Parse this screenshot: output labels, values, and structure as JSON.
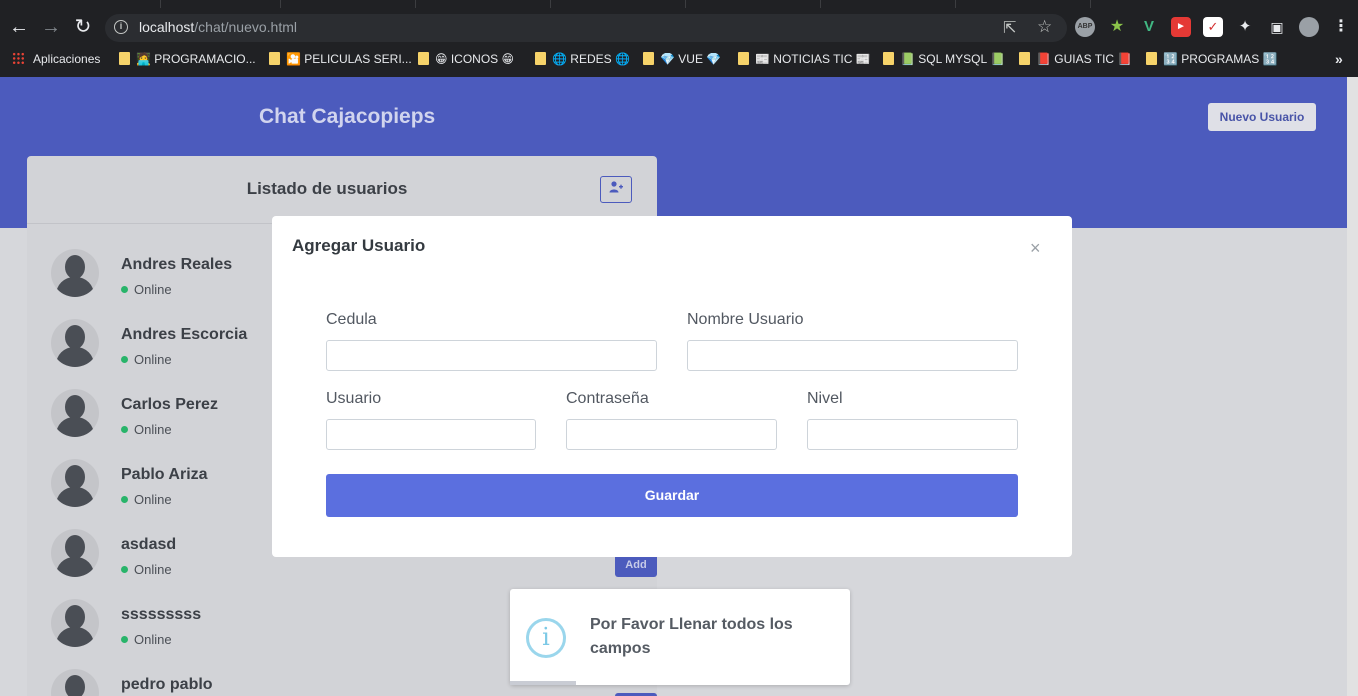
{
  "browser": {
    "url_host": "localhost",
    "url_path": "/chat/nuevo.html",
    "bookmarks": [
      {
        "label": "Aplicaciones",
        "icon": "apps-grid-icon"
      },
      {
        "label": "🧑‍💻 PROGRAMACIO...",
        "icon": "folder-icon"
      },
      {
        "label": "🎦 PELICULAS SERI...",
        "icon": "folder-icon"
      },
      {
        "label": "😁 ICONOS 😁",
        "icon": "folder-icon"
      },
      {
        "label": "🌐 REDES 🌐",
        "icon": "folder-icon"
      },
      {
        "label": "💎 VUE 💎",
        "icon": "folder-icon"
      },
      {
        "label": "📰 NOTICIAS TIC 📰",
        "icon": "folder-icon"
      },
      {
        "label": "📗 SQL MYSQL 📗",
        "icon": "folder-icon"
      },
      {
        "label": "📕 GUIAS TIC 📕",
        "icon": "folder-icon"
      },
      {
        "label": "🔢 PROGRAMAS 🔢",
        "icon": "folder-icon"
      }
    ],
    "more_bookmarks": "»"
  },
  "app": {
    "title": "Chat Cajacopieps",
    "new_user_button": "Nuevo Usuario",
    "accent": "#4c5bbd"
  },
  "panel": {
    "title": "Listado de usuarios",
    "add_icon": "user-plus-icon",
    "users": [
      {
        "name": "Andres Reales",
        "status": "Online"
      },
      {
        "name": "Andres Escorcia",
        "status": "Online"
      },
      {
        "name": "Carlos Perez",
        "status": "Online"
      },
      {
        "name": "Pablo Ariza",
        "status": "Online"
      },
      {
        "name": "asdasd",
        "status": "Online"
      },
      {
        "name": "sssssssss",
        "status": "Online"
      },
      {
        "name": "pedro pablo",
        "status": ""
      }
    ],
    "add_label": "Add"
  },
  "modal": {
    "title": "Agregar Usuario",
    "close": "×",
    "labels": {
      "cedula": "Cedula",
      "nombre": "Nombre Usuario",
      "usuario": "Usuario",
      "contrasena": "Contraseña",
      "nivel": "Nivel"
    },
    "values": {
      "cedula": "",
      "nombre": "",
      "usuario": "",
      "contrasena": "",
      "nivel": ""
    },
    "submit": "Guardar"
  },
  "toast": {
    "icon": "info-icon",
    "symbol": "i",
    "message": "Por Favor Llenar todos los campos"
  }
}
